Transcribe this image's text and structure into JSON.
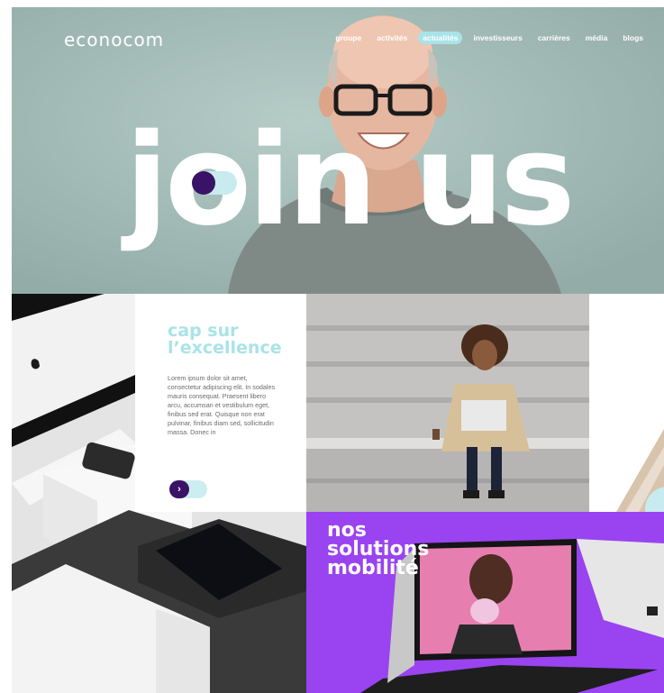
{
  "header": {
    "logo": "econocom",
    "nav": [
      {
        "label": "groupe",
        "active": false
      },
      {
        "label": "activités",
        "active": false
      },
      {
        "label": "actualités",
        "active": true
      },
      {
        "label": "investisseurs",
        "active": false
      },
      {
        "label": "carrières",
        "active": false
      },
      {
        "label": "média",
        "active": false
      },
      {
        "label": "blogs",
        "active": false
      }
    ]
  },
  "hero": {
    "headline": "join us"
  },
  "card": {
    "title_line1": "cap sur",
    "title_line2": "l’excellence",
    "body": "Lorem ipsum dolor sit amet, consectetur adipiscing elit. In sodales mauris consequat. Praesent libero arcu, accumsan et vestibulum eget, finibus sed erat. Quisque non erat pulvinar, finibus diam sed, sollicitudin massa. Donec in",
    "button_icon": "chevron-right-icon"
  },
  "purple": {
    "title_line1": "nos",
    "title_line2": "solutions",
    "title_line3": "mobilité"
  },
  "colors": {
    "accent": "#a9e3e8",
    "purple": "#9a43f0",
    "dark_purple": "#3a1266"
  }
}
